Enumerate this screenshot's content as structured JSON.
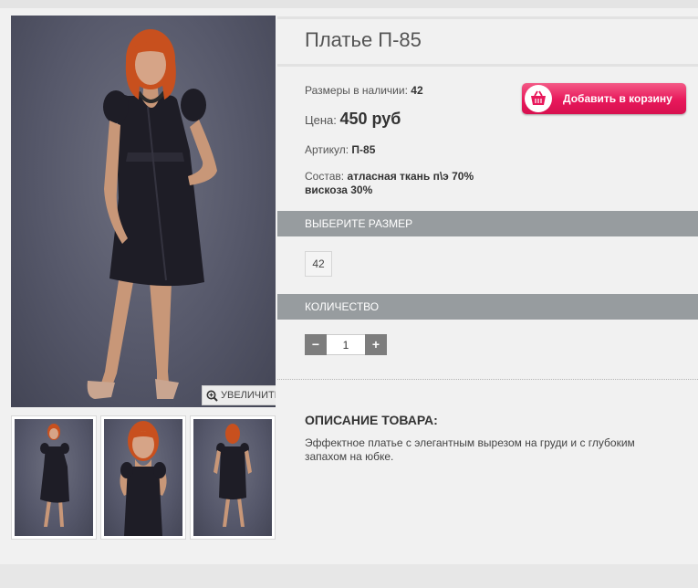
{
  "product": {
    "title": "Платье П-85",
    "sizes_in_stock_label": "Размеры в наличии:",
    "sizes_in_stock_value": "42",
    "price_label": "Цена:",
    "price_value": "450 руб",
    "article_label": "Артикул:",
    "article_value": "П-85",
    "composition_label": "Состав:",
    "composition_value_line1": "атласная ткань п\\э 70%",
    "composition_value_line2": "вискоза 30%"
  },
  "gallery": {
    "zoom_label": "УВЕЛИЧИТЬ",
    "thumbnail_count": 3
  },
  "cart": {
    "add_label": "Добавить в корзину",
    "icon": "basket-icon"
  },
  "size_section": {
    "heading": "ВЫБЕРИТЕ РАЗМЕР",
    "options": [
      "42"
    ]
  },
  "quantity_section": {
    "heading": "КОЛИЧЕСТВО",
    "minus": "−",
    "plus": "+",
    "value": "1"
  },
  "description": {
    "heading": "ОПИСАНИЕ ТОВАРА:",
    "text": "Эффектное платье с элегантным вырезом на груди и с глубоким запахом на юбке."
  },
  "colors": {
    "accent": "#e8185b",
    "section_bar": "#979c9f",
    "dress": "#1e1d26",
    "hair": "#c8501e"
  }
}
